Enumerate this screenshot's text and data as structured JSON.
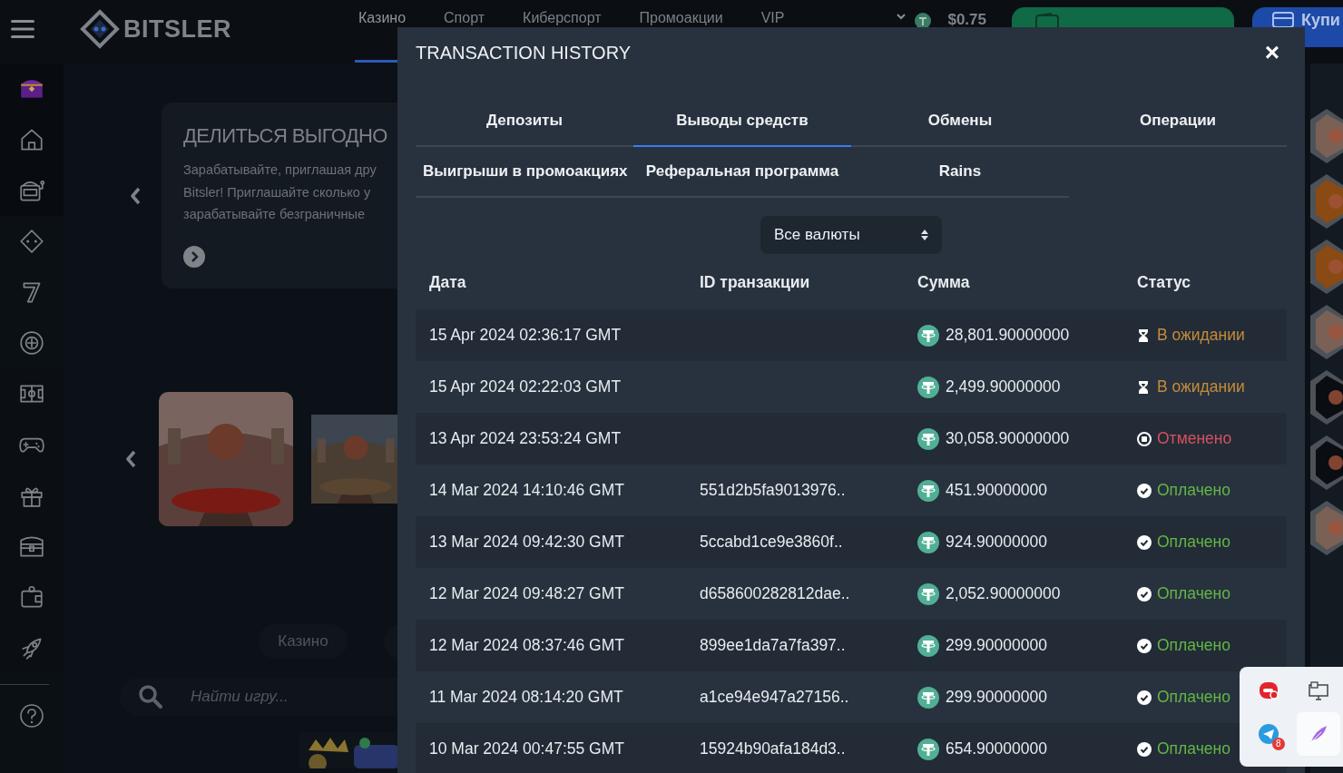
{
  "top_bar": {
    "logo": "BITSLER",
    "nav": [
      {
        "label": "Казино",
        "selected": true
      },
      {
        "label": "Спорт",
        "selected": false
      },
      {
        "label": "Киберспорт",
        "selected": false
      },
      {
        "label": "Промоакции",
        "selected": false
      },
      {
        "label": "VIP",
        "selected": false
      }
    ],
    "balance": "$0.75",
    "buy_button": "Купи"
  },
  "banner": {
    "title": "ДЕЛИТЬСЯ ВЫГОДНО",
    "lines": [
      "Зарабатывайте, приглашая дру",
      "Bitsler! Приглашайте сколько у",
      "зарабатывайте безграничные"
    ]
  },
  "category_pill": "Казино",
  "search": {
    "placeholder": "Найти игру..."
  },
  "modal": {
    "title": "TRANSACTION HISTORY",
    "close": "×",
    "tab_rows": [
      {
        "tabs": [
          {
            "label": "Депозиты",
            "selected": false
          },
          {
            "label": "Выводы средств",
            "selected": true
          },
          {
            "label": "Обмены",
            "selected": false
          },
          {
            "label": "Операции",
            "selected": false
          }
        ]
      },
      {
        "tabs": [
          {
            "label": "Выигрыши в промоакциях",
            "selected": false
          },
          {
            "label": "Реферальная программа",
            "selected": false
          },
          {
            "label": "Rains",
            "selected": false
          }
        ]
      }
    ],
    "currency_select": "Все валюты",
    "columns": [
      "Дата",
      "ID транзакции",
      "Сумма",
      "Статус"
    ],
    "rows": [
      {
        "date": "15 Apr 2024 02:36:17 GMT",
        "amount": "28,801.90000000",
        "status": "В ожидании",
        "kind": "pending"
      },
      {
        "date": "15 Apr 2024 02:22:03 GMT",
        "amount": "2,499.90000000",
        "status": "В ожидании",
        "kind": "pending"
      },
      {
        "date": "13 Apr 2024 23:53:24 GMT",
        "amount": "30,058.90000000",
        "status": "Отменено",
        "kind": "cancelled"
      },
      {
        "date": "14 Mar 2024 14:10:46 GMT",
        "tx_id": "551d2b5fa9013976..",
        "amount": "451.90000000",
        "status": "Оплачено",
        "kind": "paid"
      },
      {
        "date": "13 Mar 2024 09:42:30 GMT",
        "tx_id": "5ccabd1ce9e3860f..",
        "amount": "924.90000000",
        "status": "Оплачено",
        "kind": "paid"
      },
      {
        "date": "12 Mar 2024 09:48:27 GMT",
        "tx_id": "d658600282812dae..",
        "amount": "2,052.90000000",
        "status": "Оплачено",
        "kind": "paid"
      },
      {
        "date": "12 Mar 2024 08:37:46 GMT",
        "tx_id": "899ee1da7a7fa397..",
        "amount": "299.90000000",
        "status": "Оплачено",
        "kind": "paid"
      },
      {
        "date": "11 Mar 2024 08:14:20 GMT",
        "tx_id": "a1ce94e947a27156..",
        "amount": "299.90000000",
        "status": "Оплачено",
        "kind": "paid"
      },
      {
        "date": "10 Mar 2024 00:47:55 GMT",
        "tx_id": "15924b90afa184d3..",
        "amount": "654.90000000",
        "status": "Оплачено",
        "kind": "paid"
      }
    ]
  },
  "tray": {
    "badge": "8"
  }
}
